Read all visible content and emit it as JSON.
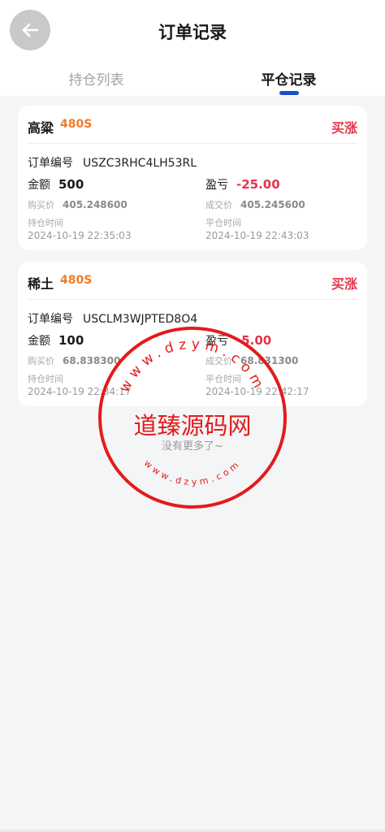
{
  "header": {
    "title": "订单记录",
    "tabs": [
      {
        "label": "持仓列表",
        "active": false
      },
      {
        "label": "平仓记录",
        "active": true
      }
    ]
  },
  "orders": [
    {
      "product": "高粱",
      "lot": "480S",
      "direction": "买涨",
      "order_label": "订单编号",
      "order_no": "USZC3RHC4LH53RL",
      "amount_label": "金额",
      "amount": "500",
      "pl_label": "盈亏",
      "pl": "-25.00",
      "buy_price_label": "购买价",
      "buy_price": "405.248600",
      "deal_price_label": "成交价",
      "deal_price": "405.245600",
      "open_time_label": "持仓时间",
      "open_time": "2024-10-19 22:35:03",
      "close_time_label": "平仓时间",
      "close_time": "2024-10-19 22:43:03"
    },
    {
      "product": "稀土",
      "lot": "480S",
      "direction": "买涨",
      "order_label": "订单编号",
      "order_no": "USCLM3WJPTED8O4",
      "amount_label": "金额",
      "amount": "100",
      "pl_label": "盈亏",
      "pl": "-5.00",
      "buy_price_label": "购买价",
      "buy_price": "68.838300",
      "deal_price_label": "成交价",
      "deal_price": "68.831300",
      "open_time_label": "持仓时间",
      "open_time": "2024-10-19 22:34:17",
      "close_time_label": "平仓时间",
      "close_time": "2024-10-19 22:42:17"
    }
  ],
  "footer": {
    "no_more": "没有更多了~"
  },
  "watermark": {
    "text": "道臻源码网",
    "ring_text": "www.dzym.com",
    "color": "#e31b1b"
  },
  "colors": {
    "accent_blue": "#1b4fc9",
    "loss_red": "#e5354b",
    "lot_orange": "#f07b26"
  }
}
